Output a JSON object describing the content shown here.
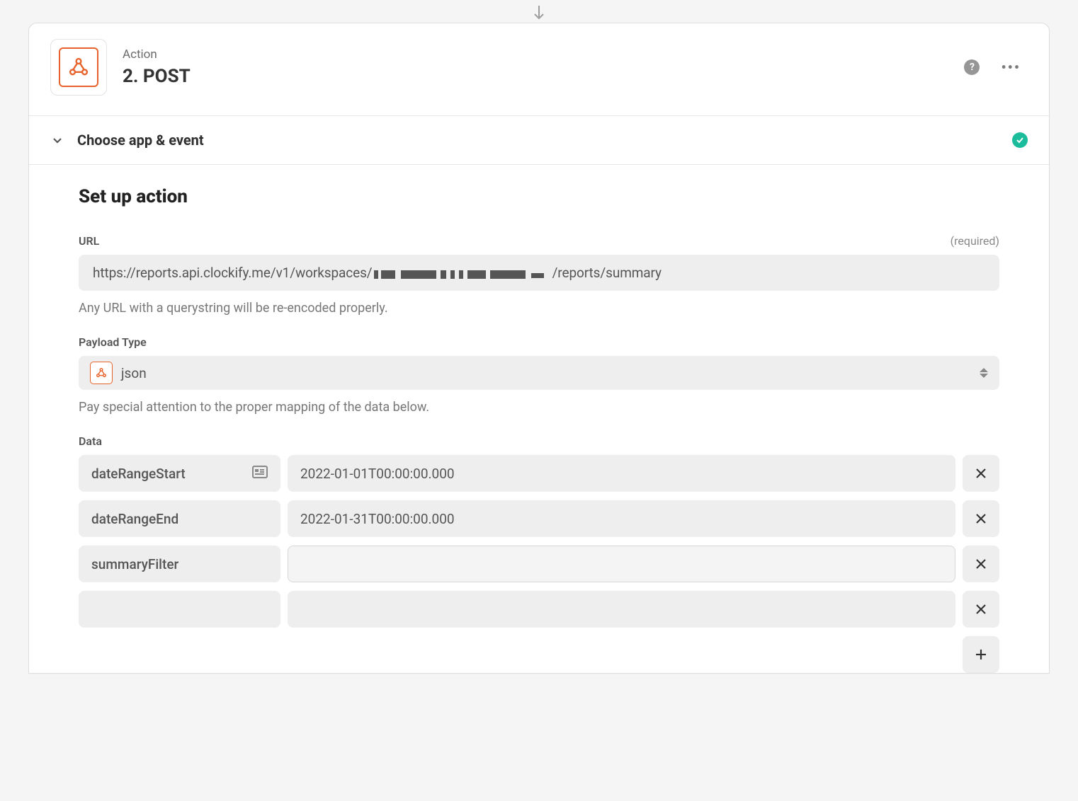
{
  "header": {
    "eyebrow": "Action",
    "title": "2. POST"
  },
  "section_choose": {
    "label": "Choose app & event",
    "completed": true
  },
  "section_setup": {
    "title": "Set up action",
    "url": {
      "label": "URL",
      "required_text": "(required)",
      "value_prefix": "https://reports.api.clockify.me/v1/workspaces/",
      "value_suffix": "/reports/summary",
      "help": "Any URL with a querystring will be re-encoded properly."
    },
    "payload": {
      "label": "Payload Type",
      "value": "json",
      "help": "Pay special attention to the proper mapping of the data below."
    },
    "data": {
      "label": "Data",
      "rows": [
        {
          "key": "dateRangeStart",
          "value": "2022-01-01T00:00:00.000",
          "has_icon": true,
          "bordered": false
        },
        {
          "key": "dateRangeEnd",
          "value": "2022-01-31T00:00:00.000",
          "has_icon": false,
          "bordered": false
        },
        {
          "key": "summaryFilter",
          "value": "",
          "has_icon": false,
          "bordered": true
        },
        {
          "key": "",
          "value": "",
          "has_icon": false,
          "bordered": false
        }
      ]
    }
  }
}
